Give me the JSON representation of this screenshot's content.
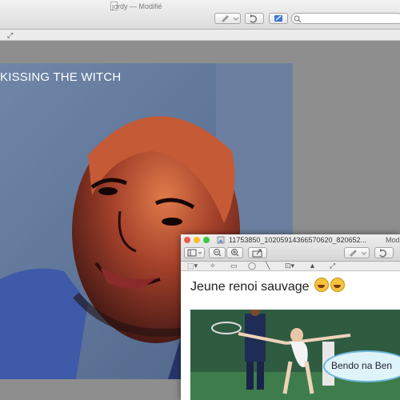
{
  "window_main": {
    "title": "jordy",
    "status": "— Modifié"
  },
  "photo": {
    "caption": "KISSING THE WITCH"
  },
  "window_secondary": {
    "title": "11753850_10205914366570620_820652...",
    "title_right": "Modi"
  },
  "post": {
    "text": "Jeune renoi sauvage"
  },
  "bubble": {
    "text": "Bendo na Ben"
  },
  "colors": {
    "close": "#f05b50",
    "minimize": "#f8be2f",
    "zoom": "#3ec542"
  }
}
